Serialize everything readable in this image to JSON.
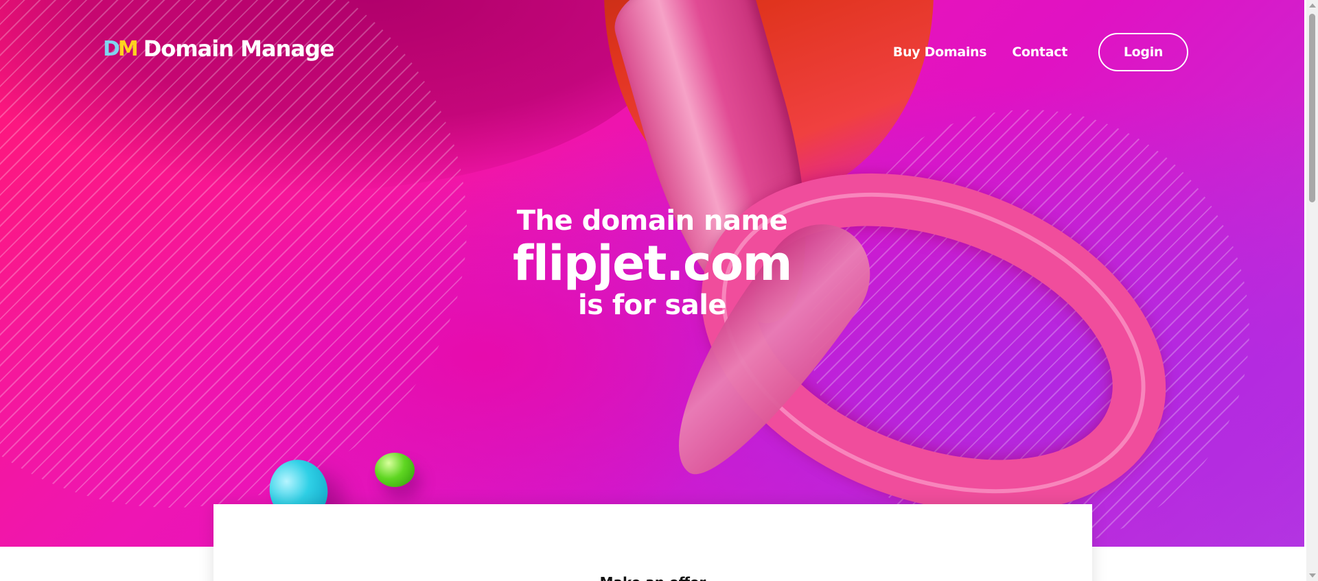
{
  "brand": {
    "logo_mark_d": "D",
    "logo_mark_m": "M",
    "name": "Domain Manage",
    "colors": {
      "mark_d": "#7fd6f0",
      "mark_m": "#ffd21f"
    }
  },
  "nav": {
    "links": [
      "Buy Domains",
      "Contact"
    ],
    "login_label": "Login"
  },
  "hero": {
    "line1": "The domain name",
    "domain": "flipjet.com",
    "line3": "is for sale",
    "colors": {
      "gradient_start": "#ff1a79",
      "gradient_mid": "#e012c3",
      "gradient_end": "#b63ae0"
    }
  },
  "offer_card": {
    "title": "Make an offer"
  }
}
